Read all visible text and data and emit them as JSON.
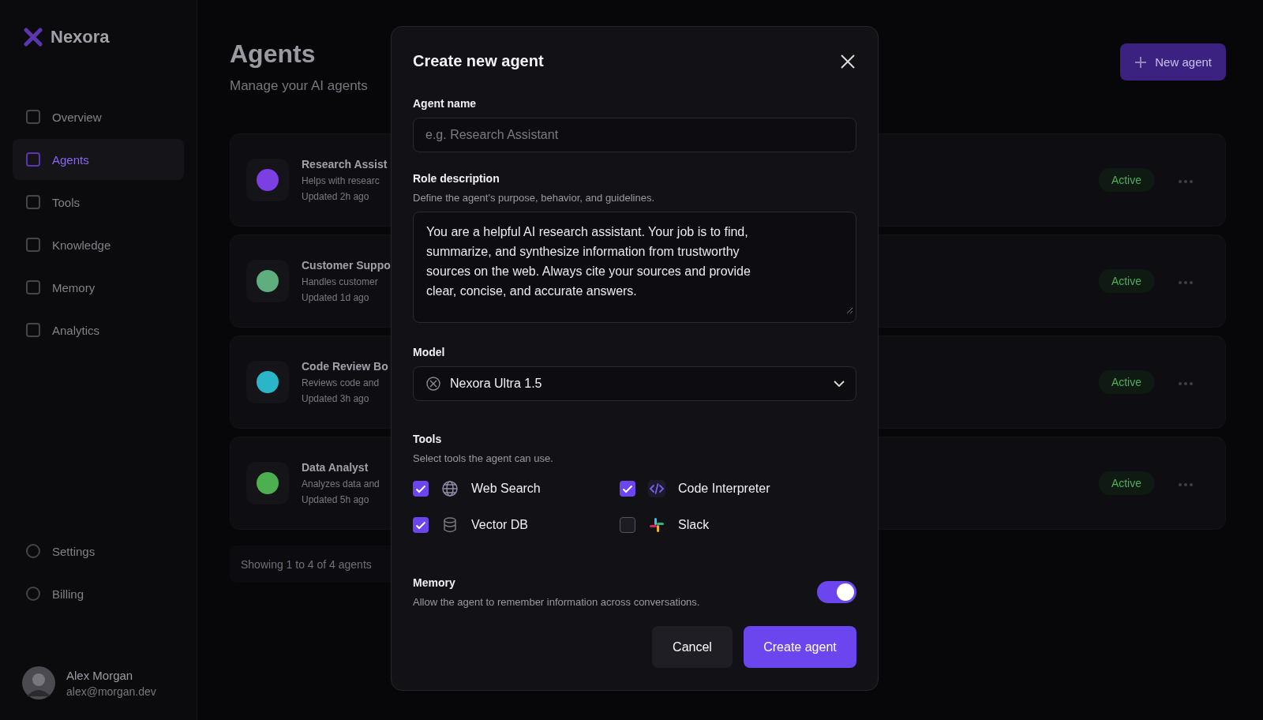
{
  "sidebar": {
    "brand": "Nexora",
    "nav": [
      {
        "label": "Overview",
        "selected": false
      },
      {
        "label": "Agents",
        "selected": true
      },
      {
        "label": "Tools",
        "selected": false
      },
      {
        "label": "Knowledge",
        "selected": false
      },
      {
        "label": "Memory",
        "selected": false
      },
      {
        "label": "Analytics",
        "selected": false
      }
    ],
    "bottom_nav": [
      {
        "label": "Settings"
      },
      {
        "label": "Billing"
      }
    ],
    "user": {
      "name": "Alex Morgan",
      "email": "alex@morgan.dev"
    }
  },
  "page": {
    "title": "Agents",
    "subtitle": "Manage your AI agents",
    "new_button": "New agent",
    "agents": [
      {
        "name": "Research Assist",
        "description": "Helps with researc",
        "updated": "Updated 2h ago",
        "status": "Active",
        "color": "#7b3fe4"
      },
      {
        "name": "Customer Suppo",
        "description": "Handles customer",
        "updated": "Updated 1d ago",
        "status": "Active",
        "color": "#5fae7e"
      },
      {
        "name": "Code Review Bo",
        "description": "Reviews code and",
        "updated": "Updated 3h ago",
        "status": "Active",
        "color": "#2bb5c9"
      },
      {
        "name": "Data Analyst",
        "description": "Analyzes data and",
        "updated": "Updated 5h ago",
        "status": "Active",
        "color": "#4caf50"
      }
    ],
    "footer": "Showing 1 to 4 of 4 agents"
  },
  "dialog": {
    "title": "Create new agent",
    "name_label": "Agent name",
    "name_placeholder": "e.g. Research Assistant",
    "role_label": "Role description",
    "role_hint": "Define the agent's purpose, behavior, and guidelines.",
    "role_value": "You are a helpful AI research assistant. Your job is to find, summarize, and synthesize information from trustworthy sources on the web. Always cite your sources and provide clear, concise, and accurate answers.",
    "model_label": "Model",
    "model_value": "Nexora Ultra 1.5",
    "tools_label": "Tools",
    "tools_hint": "Select tools the agent can use.",
    "tools": [
      {
        "label": "Web Search",
        "checked": true,
        "kind": "globe"
      },
      {
        "label": "Code Interpreter",
        "checked": true,
        "kind": "code"
      },
      {
        "label": "Vector DB",
        "checked": true,
        "kind": "database"
      },
      {
        "label": "Slack",
        "checked": false,
        "kind": "slack"
      }
    ],
    "memory": {
      "label": "Memory",
      "hint": "Allow the agent to remember information across conversations.",
      "on": true
    },
    "buttons": {
      "cancel": "Cancel",
      "create": "Create agent"
    }
  }
}
